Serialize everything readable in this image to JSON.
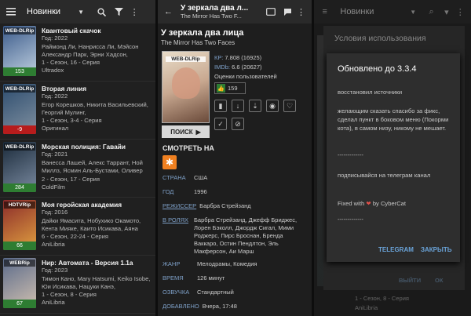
{
  "list": {
    "title": "Новинки",
    "items": [
      {
        "quality": "WEB-DLRip",
        "count": "153",
        "count_color": "#2e7d32",
        "poster": [
          "#3a5a8a",
          "#c0d0e0"
        ],
        "name": "Квантовый скачок",
        "line1": "Год: 2022",
        "line2": "Раймонд Ли, Нанрисса Ли, Мэйсон Александр Парк, Эрни Хадсон,",
        "line3": "1 - Сезон, 16 - Серия",
        "line4": "Ultradox"
      },
      {
        "quality": "WEB-DLRip",
        "count": "-9",
        "count_color": "#b71c1c",
        "poster": [
          "#2c4c6e",
          "#8090a0"
        ],
        "name": "Вторая линия",
        "line1": "Год: 2022",
        "line2": "Егор Корешков, Никита Васильевский, Георгий Мулинг,",
        "line3": "1 - Сезон, 3-4 - Серия",
        "line4": "Оригинал"
      },
      {
        "quality": "WEB-DLRip",
        "count": "284",
        "count_color": "#2e7d32",
        "poster": [
          "#1a2a3a",
          "#7a8aa0"
        ],
        "name": "Морская полиция: Гавайи",
        "line1": "Год: 2021",
        "line2": "Ванесса Лашей, Алекс Таррант, Ной Миллз, Ясмин Аль-Бустами, Оливер Гойхэй, Дарни",
        "line3": "2 - Сезон, 17 - Серия",
        "line4": "ColdFilm"
      },
      {
        "quality": "HDTVRip",
        "count": "66",
        "count_color": "#2e7d32",
        "poster": [
          "#8a2a2a",
          "#e0a040"
        ],
        "name": "Моя геройская академия",
        "line1": "Год: 2016",
        "line2": "Дайки Ямасита, Нобухико Окамото, Кента Мияке, Каито Исикава, Аяна",
        "line3": "6 - Сезон, 22-24 - Серия",
        "line4": "AniLibria"
      },
      {
        "quality": "WEBRip",
        "count": "67",
        "count_color": "#2e7d32",
        "poster": [
          "#5a6a8a",
          "#d0c0b0"
        ],
        "name": "Нир: Автомата - Версия 1.1а",
        "line1": "Год: 2023",
        "line2": "Тимон Кано, Mary Hatsumi, Keiko Isobe, Юи Исикава, Нацуки Канэ,",
        "line3": "1 - Сезон, 8 - Серия",
        "line4": "AniLibria"
      }
    ]
  },
  "detail": {
    "header_title": "У зеркала два л...",
    "header_subtitle": "The Mirror Has Two F...",
    "title": "У зеркала два лица",
    "original_title": "The Mirror Has Two Faces",
    "poster_quality": "WEB-DLRip",
    "kp_label": "КР:",
    "kp": "7.808 (16925)",
    "imdb_label": "IMDb:",
    "imdb": "6.6 (20627)",
    "user_ratings": "Оценки пользователей",
    "likes": "159",
    "search_label": "ПОИСК",
    "watch_on": "СМОТРЕТЬ НА",
    "fields": [
      {
        "label": "СТРАНА",
        "value": "США"
      },
      {
        "label": "ГОД",
        "value": "1996"
      },
      {
        "label": "РЕЖИССЕР",
        "value": "Барбра Стрейзанд"
      },
      {
        "label": "В РОЛЯХ",
        "value": "Барбра Стрейзанд, Джефф Бриджес, Лорен Бэколл, Джордж Сигал, Мими Роджерс, Пирс Броснан, Бренда Ваккаро, Остин Пендлтон, Эль Макферсон, Аи Марш"
      },
      {
        "label": "ЖАНР",
        "value": "Мелодрамы, Комедия"
      },
      {
        "label": "ВРЕМЯ",
        "value": "126 минут"
      },
      {
        "label": "ОЗВУЧКА",
        "value": "Стандартный"
      },
      {
        "label": "ДОБАВЛЕНО",
        "value": "Вчера, 17:48"
      }
    ]
  },
  "background": {
    "title": "Новинки",
    "snippet1": "1 - Сезон, 8 - Серия",
    "snippet2": "AniLibria"
  },
  "dialog_behind": {
    "title": "Условия использования",
    "exit": "ВЫЙТИ",
    "ok": "ОК"
  },
  "dialog": {
    "title": "Обновлено до 3.3.4",
    "line1": "восстановил источники",
    "line2": "желающим сказать спасибо за фикс, сделал пункт в боковом меню (Покорми кота), в самом низу, никому не мешает.",
    "sep1": "-------------",
    "line3": "подписывайся на телеграм канал",
    "fixed_with": "Fixed with",
    "by": "by CyberCat",
    "sep2": "-------------",
    "telegram": "TELEGRAM",
    "close": "ЗАКРЫТЬ"
  },
  "colors": {
    "accent": "#6aa3d8",
    "like": "#2e7d32",
    "heart": "#e0504a",
    "orange": "#f08020"
  }
}
